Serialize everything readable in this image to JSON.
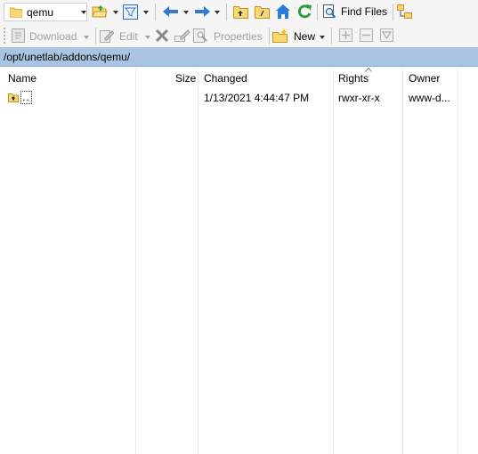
{
  "toolbar1": {
    "current_folder": "qemu",
    "find_files_label": "Find Files"
  },
  "toolbar2": {
    "download_label": "Download",
    "edit_label": "Edit",
    "properties_label": "Properties",
    "new_label": "New"
  },
  "path": "/opt/unetlab/addons/qemu/",
  "file_list": {
    "columns": [
      {
        "key": "name",
        "label": "Name"
      },
      {
        "key": "size",
        "label": "Size"
      },
      {
        "key": "changed",
        "label": "Changed"
      },
      {
        "key": "rights",
        "label": "Rights",
        "sorted": "ascending"
      },
      {
        "key": "owner",
        "label": "Owner"
      }
    ],
    "rows": [
      {
        "name": "..",
        "size": "",
        "changed": "1/13/2021 4:44:47 PM",
        "rights": "rwxr-xr-x",
        "owner": "www-d..."
      }
    ]
  },
  "colors": {
    "path_bar": "#a9c4e2",
    "toolbar_bg": "#f5f5f5",
    "folder_yellow": "#f8d775",
    "nav_blue": "#2e7bd6",
    "refresh_green": "#2e9e3a",
    "delete_gray": "#8a8a8a"
  },
  "icons": [
    "folder-icon",
    "open-folder-icon",
    "filter-icon",
    "back-arrow-icon",
    "forward-arrow-icon",
    "parent-directory-icon",
    "root-directory-icon",
    "home-icon",
    "refresh-icon",
    "find-files-icon",
    "tree-icon",
    "download-icon",
    "edit-icon",
    "delete-icon",
    "rename-icon",
    "properties-icon",
    "new-icon",
    "add-icon",
    "remove-icon",
    "filter-mask-icon",
    "sort-ascending-icon",
    "parent-folder-row-icon"
  ]
}
